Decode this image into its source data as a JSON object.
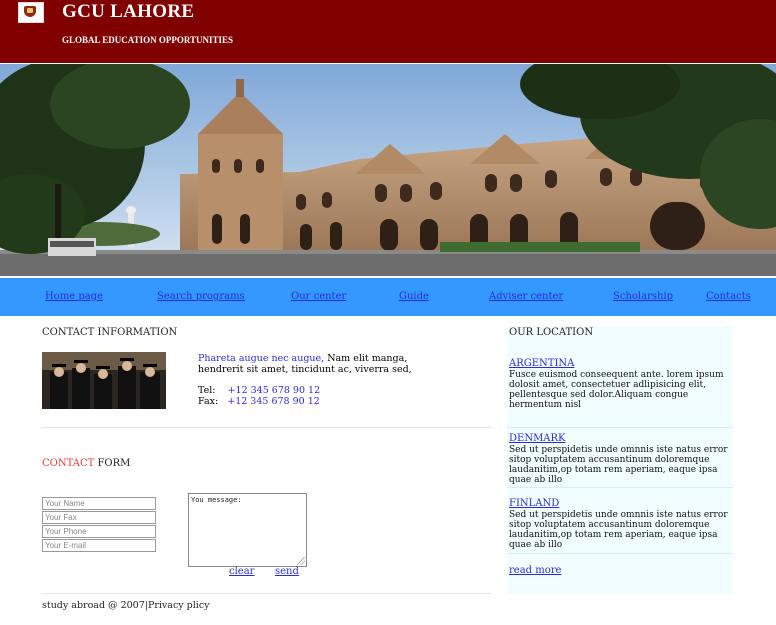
{
  "header": {
    "title": "GCU LAHORE",
    "tagline": "GLOBAL EDUCATION OPPORTUNITIES",
    "background_color": "#800000"
  },
  "nav": {
    "background_color": "#3399ff",
    "items": [
      "Home page",
      "Search programs",
      "Our center",
      "Guide",
      "Adviser center",
      "Scholarship",
      "Contacts"
    ]
  },
  "contact_info": {
    "title": "CONTACT INFORMATION",
    "highlight": "Phareta augue nec augue,",
    "text_rest": " Nam elit manga,",
    "text_line2": "hendrerit sit amet, tincidunt ac, viverra sed,",
    "tel_label": "Tel:",
    "tel_value": "+12 345 678 90 12",
    "fax_label": "Fax:",
    "fax_value": "+12 345 678 90 12"
  },
  "contact_form": {
    "title_highlight": "CONTACT",
    "title_rest": " FORM",
    "name_placeholder": "Your Name",
    "fax_placeholder": "Your Fax",
    "phone_placeholder": "Your Phone",
    "email_placeholder": "Your E-mail",
    "message_placeholder": "You message:",
    "clear_label": "clear",
    "send_label": "send"
  },
  "location": {
    "title": "OUR LOCATION",
    "items": [
      {
        "name": "ARGENTINA",
        "text": "Fusce euismod conseequent ante. lorem ipsum dolosit amet, consectetuer adlipisicing elit, pellentesque sed dolor.Aliquam congue hermentum nisl"
      },
      {
        "name": "DENMARK",
        "text": "Sed ut perspidetis unde omnnis iste natus error sitop voluptatem accusantinum doloremque laudanitim,op totam rem aperiam, eaque ipsa quae ab illo"
      },
      {
        "name": "FINLAND",
        "text": "Sed ut perspidetis unde omnnis iste natus error sitop voluptatem accusantinum doloremque laudanitim,op totam rem aperiam, eaque ipsa quae ab illo"
      }
    ],
    "read_more_label": "read more"
  },
  "footer": {
    "text": "study abroad @ 2007|Privacy plicy"
  }
}
